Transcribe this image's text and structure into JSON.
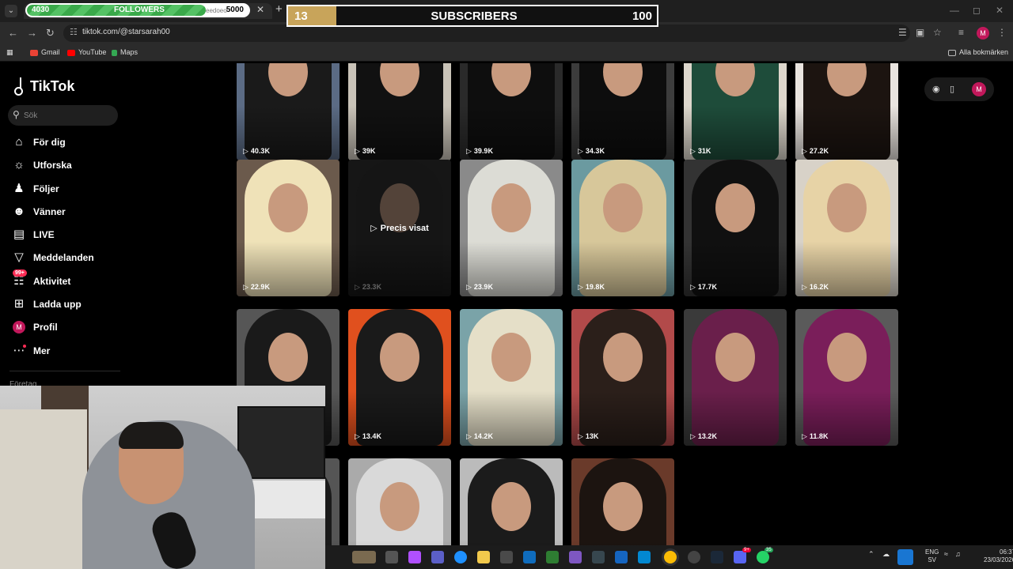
{
  "overlay": {
    "followers": {
      "current": "4030",
      "label": "FOLLOWERS",
      "goal": "5000",
      "ghost": "eedoeo",
      "progress": 0.806
    },
    "subscribers": {
      "current": "13",
      "label": "SUBSCRIBERS",
      "goal": "100",
      "progress": 0.13
    }
  },
  "browser": {
    "url": "tiktok.com/@starsarah00",
    "bookmarks": [
      "Gmail",
      "YouTube",
      "Maps"
    ],
    "all_bookmarks": "Alla bokmärken",
    "profile_initial": "M"
  },
  "tiktok": {
    "logo": "TikTok",
    "search_placeholder": "Sök",
    "nav": [
      {
        "label": "För dig",
        "icon": "home-icon"
      },
      {
        "label": "Utforska",
        "icon": "compass-icon"
      },
      {
        "label": "Följer",
        "icon": "following-icon"
      },
      {
        "label": "Vänner",
        "icon": "friends-icon"
      },
      {
        "label": "LIVE",
        "icon": "live-icon"
      },
      {
        "label": "Meddelanden",
        "icon": "messages-icon"
      },
      {
        "label": "Aktivitet",
        "icon": "activity-icon",
        "badge": "99+"
      },
      {
        "label": "Ladda upp",
        "icon": "upload-icon"
      },
      {
        "label": "Profil",
        "icon": "profile-avatar",
        "initial": "M"
      },
      {
        "label": "Mer",
        "icon": "more-icon"
      }
    ],
    "footer": "Företag",
    "precis_visat": "Precis visat",
    "views": [
      [
        "40.3K",
        "39K",
        "39.9K",
        "34.3K",
        "31K",
        "27.2K"
      ],
      [
        "22.9K",
        "23.3K",
        "23.9K",
        "19.8K",
        "17.7K",
        "16.2K"
      ],
      [
        "",
        "13.4K",
        "14.2K",
        "13K",
        "13.2K",
        "11.8K"
      ],
      [
        "",
        "",
        "",
        ""
      ]
    ]
  },
  "taskbar": {
    "lang_top": "ENG",
    "lang_bottom": "SV",
    "time": "06:37",
    "date": "23/03/2026",
    "discord_badge": "9+",
    "whatsapp_badge": "35"
  }
}
